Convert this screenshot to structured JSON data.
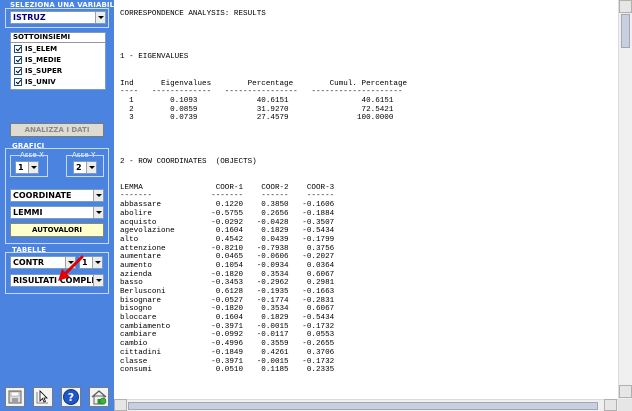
{
  "sidebar": {
    "variable_group_title": "SELEZIONA UNA VARIABILE",
    "variable_value": "ISTRUZ",
    "subsets_title": "SOTTOINSIEMI",
    "subsets": [
      {
        "label": "IS_ELEM",
        "checked": true
      },
      {
        "label": "IS_MEDIE",
        "checked": true
      },
      {
        "label": "IS_SUPER",
        "checked": true
      },
      {
        "label": "IS_UNIV",
        "checked": true
      }
    ],
    "analyze_button": "ANALIZZA I DATI",
    "charts_group_title": "GRAFICI",
    "axis_x_label": "Asse X",
    "axis_x_value": "1",
    "axis_y_label": "Asse Y",
    "axis_y_value": "2",
    "coord_value": "COORDINATE",
    "lemmi_value": "LEMMI",
    "eigen_button": "AUTOVALORI",
    "tables_group_title": "TABELLE",
    "contr_value": "CONTR",
    "contr_num_value": "1",
    "results_value": "RISULTATI COMPLE",
    "accent_color": "#4a84e0"
  },
  "tools": [
    {
      "name": "save-icon"
    },
    {
      "name": "cursor-click-icon"
    },
    {
      "name": "help-icon",
      "glyph": "?"
    },
    {
      "name": "home-icon"
    }
  ],
  "report": {
    "lines": [
      "CORRESPONDENCE ANALYSIS: RESULTS",
      "",
      "",
      "",
      "",
      "1 - EIGENVALUES",
      "",
      "",
      "Ind      Eigenvalues        Percentage        Cumul. Percentage",
      "----   -------------   ----------------   --------------------",
      "  1        0.1093             40.6151                40.6151",
      "  2        0.0859             31.9270                72.5421",
      "  3        0.0739             27.4579               100.0000",
      "",
      "",
      "",
      "",
      "2 - ROW COORDINATES  (OBJECTS)",
      "",
      "",
      "LEMMA                COOR-1    COOR-2    COOR-3",
      "-------             -------    ------    ------",
      "abbassare            0.1220    0.3850   -0.1606",
      "abolire             -0.5755    0.2656   -0.1884",
      "acquisto            -0.0292   -0.0428   -0.3507",
      "agevolazione         0.1604    0.1829   -0.5434",
      "alto                 0.4542    0.0439   -0.1799",
      "attenzione          -0.8210   -0.7938    0.3756",
      "aumentare            0.0465   -0.0606   -0.2027",
      "aumento              0.1054   -0.0934    0.0364",
      "azienda             -0.1820    0.3534    0.6067",
      "basso               -0.3453   -0.2962    0.2981",
      "Berlusconi           0.6128   -0.1935   -0.1663",
      "bisognare           -0.0527   -0.1774   -0.2831",
      "bisogno             -0.1820    0.3534    0.6067",
      "bloccare             0.1604    0.1829   -0.5434",
      "cambiamento         -0.3971   -0.0015   -0.1732",
      "cambiare            -0.0992   -0.0117    0.0553",
      "cambio              -0.4996    0.3559   -0.2655",
      "cittadini           -0.1849    0.4261    0.3706",
      "classe              -0.3971   -0.0015   -0.1732",
      "consumi              0.0510    0.1185    0.2335"
    ]
  }
}
